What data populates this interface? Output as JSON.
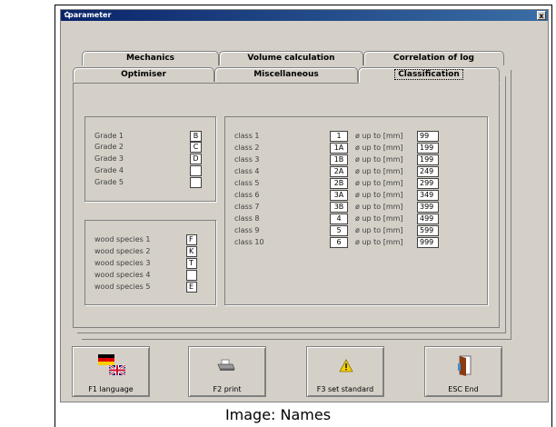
{
  "window": {
    "title": "parameter",
    "close_label": "x"
  },
  "tabs_row1": [
    "Mechanics",
    "Volume calculation",
    "Correlation of log"
  ],
  "tabs_row2": [
    "Optimiser",
    "Miscellaneous",
    "Classification"
  ],
  "active_tab": "Classification",
  "grades": [
    {
      "label": "Grade 1",
      "value": "B"
    },
    {
      "label": "Grade 2",
      "value": "C"
    },
    {
      "label": "Grade 3",
      "value": "D"
    },
    {
      "label": "Grade 4",
      "value": ""
    },
    {
      "label": "Grade 5",
      "value": ""
    }
  ],
  "wood_species": [
    {
      "label": "wood species 1",
      "value": "F"
    },
    {
      "label": "wood species 2",
      "value": "K"
    },
    {
      "label": "wood species 3",
      "value": "T"
    },
    {
      "label": "wood species 4",
      "value": ""
    },
    {
      "label": "wood species 5",
      "value": "E"
    }
  ],
  "classes": [
    {
      "label": "class 1",
      "code": "1",
      "upto": "ø up to [mm]",
      "value": "99"
    },
    {
      "label": "class 2",
      "code": "1A",
      "upto": "ø up to [mm]",
      "value": "199"
    },
    {
      "label": "class 3",
      "code": "1B",
      "upto": "ø up to [mm]",
      "value": "199"
    },
    {
      "label": "class 4",
      "code": "2A",
      "upto": "ø up to [mm]",
      "value": "249"
    },
    {
      "label": "class 5",
      "code": "2B",
      "upto": "ø up to [mm]",
      "value": "299"
    },
    {
      "label": "class 6",
      "code": "3A",
      "upto": "ø up to [mm]",
      "value": "349"
    },
    {
      "label": "class 7",
      "code": "3B",
      "upto": "ø up to [mm]",
      "value": "399"
    },
    {
      "label": "class 8",
      "code": "4",
      "upto": "ø up to [mm]",
      "value": "499"
    },
    {
      "label": "class 9",
      "code": "5",
      "upto": "ø up to [mm]",
      "value": "599"
    },
    {
      "label": "class 10",
      "code": "6",
      "upto": "ø up to [mm]",
      "value": "999"
    }
  ],
  "buttons": {
    "language": "F1 language",
    "print": "F2 print",
    "standard": "F3 set standard",
    "end": "ESC End"
  },
  "caption": "Image: Names",
  "colors": {
    "dialog_bg": "#d4d0c8",
    "titlebar": "#0a246a",
    "warning": "#f5d000",
    "door": "#8b3a12"
  }
}
